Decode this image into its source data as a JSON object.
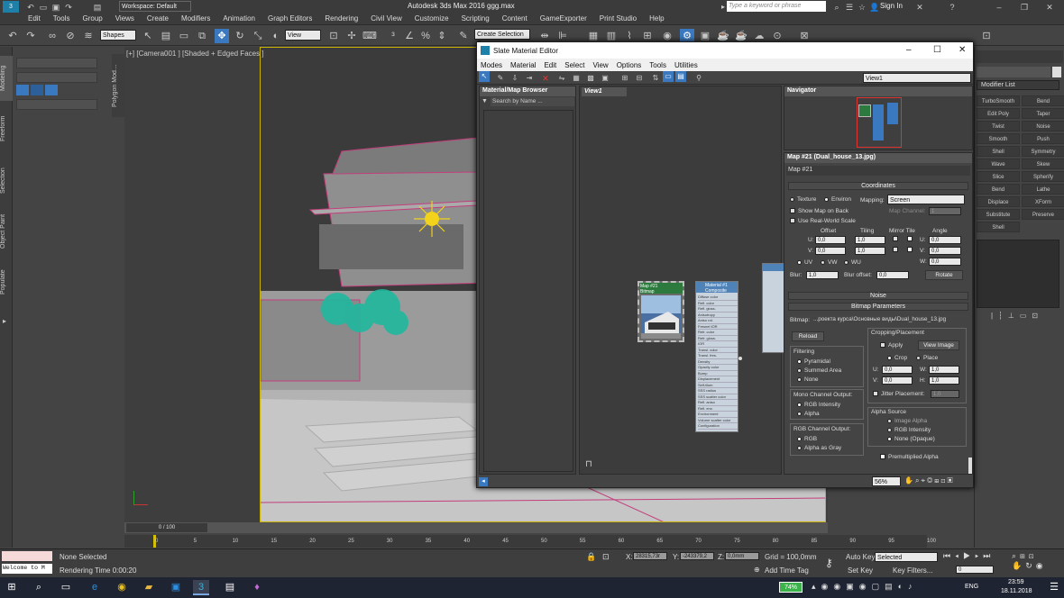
{
  "app": {
    "title": "Autodesk 3ds Max 2016",
    "file": "ggg.max",
    "workspace": "Workspace: Default",
    "search_placeholder": "Type a keyword or phrase",
    "sign_in": "Sign In"
  },
  "menu": [
    "Edit",
    "Tools",
    "Group",
    "Views",
    "Create",
    "Modifiers",
    "Animation",
    "Graph Editors",
    "Rendering",
    "Civil View",
    "Customize",
    "Scripting",
    "Content",
    "GameExporter",
    "Print Studio",
    "Help"
  ],
  "toolbar": {
    "filter": "Shapes",
    "ref_coord": "View",
    "selection_set": "Create Selection Se"
  },
  "left_tabs": [
    "Modeling",
    "Freeform",
    "Selection",
    "Object Paint",
    "Populate"
  ],
  "ribbon_side": "Polygon Mod…",
  "viewport": {
    "label": "[+] [Camera001 ] [Shaded + Edged Faces ]"
  },
  "slate": {
    "title": "Slate Material Editor",
    "menu": [
      "Modes",
      "Material",
      "Edit",
      "Select",
      "View",
      "Options",
      "Tools",
      "Utilities"
    ],
    "view_dropdown": "View1",
    "browser_title": "Material/Map Browser",
    "browser_search": "Search by Name ...",
    "view_tab": "View1",
    "navigator_title": "Navigator",
    "map_title": "Map #21 (Dual_house_13.jpg)",
    "map_name": "Map #21",
    "node_bitmap": "Map #21\nBitmap",
    "node_material": "Material #1\nComposite",
    "node_ports": [
      "Diffuse color",
      "Refl. color",
      "Refl. gloss.",
      "Anisotropy",
      "Aniso rot.",
      "Fresnel IOR",
      "Refr. color",
      "Refr. gloss.",
      "IOR",
      "Transl. color",
      "Transl. fres.",
      "Density",
      "Opacity color",
      "Bump",
      "Displacement",
      "Self-illum",
      "SSS radius",
      "SSS scatter color",
      "Refl. aniso",
      "Refl. env.",
      "Environment",
      "Volume scatter color",
      "Configuration"
    ],
    "zoom": "56%",
    "coordinates": {
      "title": "Coordinates",
      "texture": "Texture",
      "environ": "Environ",
      "mapping_label": "Mapping:",
      "mapping": "Screen",
      "show_map": "Show Map on Back",
      "map_channel": "Map Channel:",
      "map_channel_val": "1",
      "real_world": "Use Real-World Scale",
      "offset": "Offset",
      "tiling": "Tiling",
      "mirror_tile": "Mirror Tile",
      "angle": "Angle",
      "u": "U:",
      "v": "V:",
      "w": "W:",
      "u_off": "0,0",
      "v_off": "0,0",
      "u_til": "1,0",
      "v_til": "1,0",
      "u_ang": "0,0",
      "v_ang": "0,0",
      "w_ang": "0,0",
      "uv": "UV",
      "vw": "VW",
      "wu": "WU",
      "blur": "Blur:",
      "blur_val": "1,0",
      "blur_off": "Blur offset:",
      "blur_off_val": "0,0",
      "rotate": "Rotate"
    },
    "noise": "Noise",
    "bitmap_params": {
      "title": "Bitmap Parameters",
      "bitmap_label": "Bitmap:",
      "bitmap_path": "...роекта курса\\Основные виды\\Dual_house_13.jpg",
      "reload": "Reload",
      "cropping": "Cropping/Placement",
      "apply": "Apply",
      "view_image": "View Image",
      "crop": "Crop",
      "place": "Place",
      "u": "U:",
      "v": "V:",
      "w": "W:",
      "h": "H:",
      "u_val": "0,0",
      "v_val": "0,0",
      "w_val": "1,0",
      "h_val": "1,0",
      "jitter": "Jitter Placement:",
      "jitter_val": "1,0",
      "filtering": "Filtering",
      "pyramidal": "Pyramidal",
      "summed": "Summed Area",
      "none": "None",
      "mono": "Mono Channel Output:",
      "rgb_int": "RGB Intensity",
      "alpha": "Alpha",
      "rgb_ch": "RGB Channel Output:",
      "rgb": "RGB",
      "alpha_gray": "Alpha as Gray",
      "alpha_src": "Alpha Source",
      "img_alpha": "Image Alpha",
      "rgb_int2": "RGB Intensity",
      "none_opaque": "None (Opaque)",
      "premult": "Premultiplied Alpha"
    }
  },
  "modifier_list": "Modifier List",
  "modifiers": [
    "TurboSmooth",
    "Bend",
    "Edit Poly",
    "Taper",
    "Twist",
    "Noise",
    "Smooth",
    "Push",
    "Shell",
    "Symmetry",
    "Wave",
    "Skew",
    "Slice",
    "Spherify",
    "Bend",
    "Lathe",
    "Displace",
    "XForm",
    "Substitute",
    "Preserve",
    "Shell"
  ],
  "timeline": {
    "frame": "0 / 100",
    "ticks": [
      "0",
      "5",
      "10",
      "15",
      "20",
      "25",
      "30",
      "35",
      "40",
      "45",
      "50",
      "55",
      "60",
      "65",
      "70",
      "75",
      "80",
      "85",
      "90",
      "95",
      "100"
    ]
  },
  "status": {
    "maxscript": "Welcome to M",
    "selected": "None Selected",
    "render_time": "Rendering Time  0:00:20",
    "x": "28315,73r",
    "y": "-243379,2",
    "z": "0,0mm",
    "grid": "Grid = 100,0mm",
    "add_time_tag": "Add Time Tag",
    "auto_key": "Auto Key",
    "set_key": "Set Key",
    "key_sel": "Selected",
    "key_filters": "Key Filters...",
    "frame_val": "0"
  },
  "taskbar": {
    "battery": "74%",
    "lang": "ENG",
    "time": "23:59",
    "date": "18.11.2018"
  }
}
